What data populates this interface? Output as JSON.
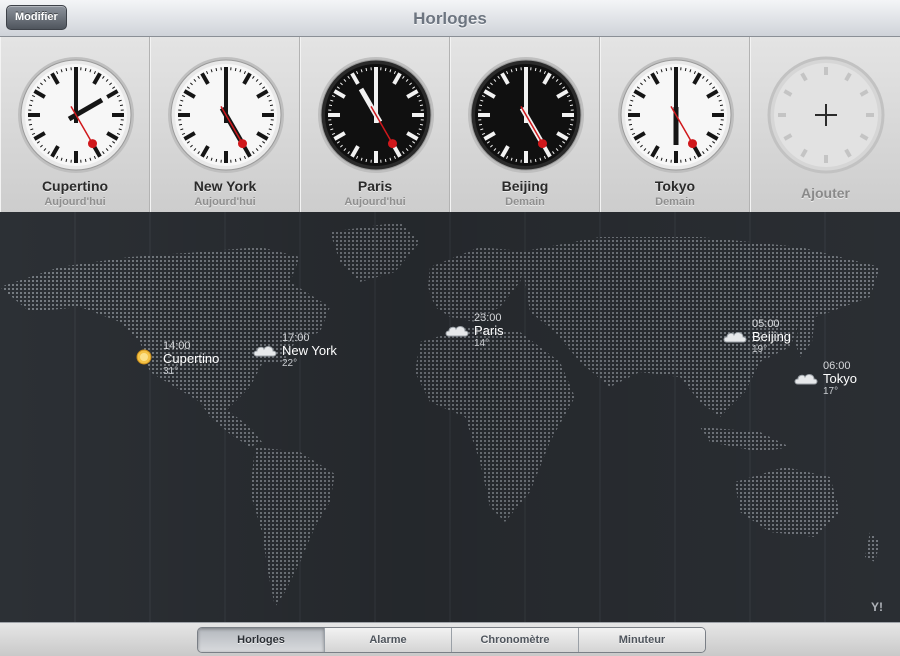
{
  "header": {
    "title": "Horloges",
    "edit_label": "Modifier"
  },
  "clocks": [
    {
      "city": "Cupertino",
      "day": "Aujourd'hui",
      "time": "14:00",
      "theme": "light"
    },
    {
      "city": "New York",
      "day": "Aujourd'hui",
      "time": "17:00",
      "theme": "light"
    },
    {
      "city": "Paris",
      "day": "Aujourd'hui",
      "time": "23:00",
      "theme": "dark"
    },
    {
      "city": "Beijing",
      "day": "Demain",
      "time": "05:00",
      "theme": "dark"
    },
    {
      "city": "Tokyo",
      "day": "Demain",
      "time": "06:00",
      "theme": "light"
    }
  ],
  "add_clock": {
    "label": "Ajouter",
    "icon": "plus-icon"
  },
  "map_pins": [
    {
      "city": "Cupertino",
      "time": "14:00",
      "temp": "31°",
      "weather": "sun-icon"
    },
    {
      "city": "New York",
      "time": "17:00",
      "temp": "22°",
      "weather": "cloud-icon"
    },
    {
      "city": "Paris",
      "time": "23:00",
      "temp": "14°",
      "weather": "cloud-icon"
    },
    {
      "city": "Beijing",
      "time": "05:00",
      "temp": "19°",
      "weather": "cloud-icon"
    },
    {
      "city": "Tokyo",
      "time": "06:00",
      "temp": "17°",
      "weather": "cloud-icon"
    }
  ],
  "map_credit": "Y!",
  "tabs": [
    {
      "label": "Horloges",
      "active": true
    },
    {
      "label": "Alarme",
      "active": false
    },
    {
      "label": "Chronomètre",
      "active": false
    },
    {
      "label": "Minuteur",
      "active": false
    }
  ]
}
